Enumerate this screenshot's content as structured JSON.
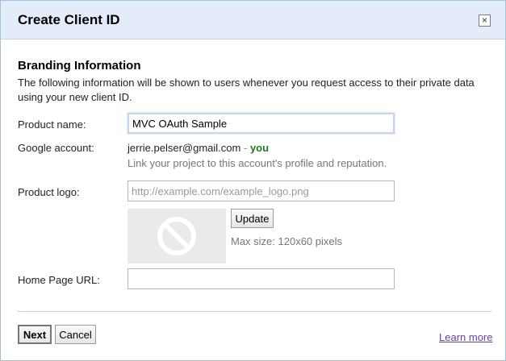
{
  "dialog": {
    "title": "Create Client ID",
    "close_glyph": "×"
  },
  "branding": {
    "heading": "Branding Information",
    "description": "The following information will be shown to users whenever you request access to their private data using your new client ID."
  },
  "form": {
    "product_name": {
      "label": "Product name:",
      "value": "MVC OAuth Sample"
    },
    "google_account": {
      "label": "Google account:",
      "email": "jerrie.pelser@gmail.com",
      "separator": "-",
      "you": "you",
      "hint": "Link your project to this account's profile and reputation."
    },
    "product_logo": {
      "label": "Product logo:",
      "placeholder": "http://example.com/example_logo.png",
      "update_label": "Update",
      "max_size": "Max size: 120x60 pixels",
      "placeholder_icon": "no-image-icon"
    },
    "home_page": {
      "label": "Home Page URL:",
      "value": ""
    }
  },
  "footer": {
    "next_label": "Next",
    "cancel_label": "Cancel",
    "learn_more": "Learn more"
  },
  "colors": {
    "titlebar_bg": "#e5ecf9",
    "you_color": "#1f7a1f",
    "link_color": "#6a3fa0"
  }
}
